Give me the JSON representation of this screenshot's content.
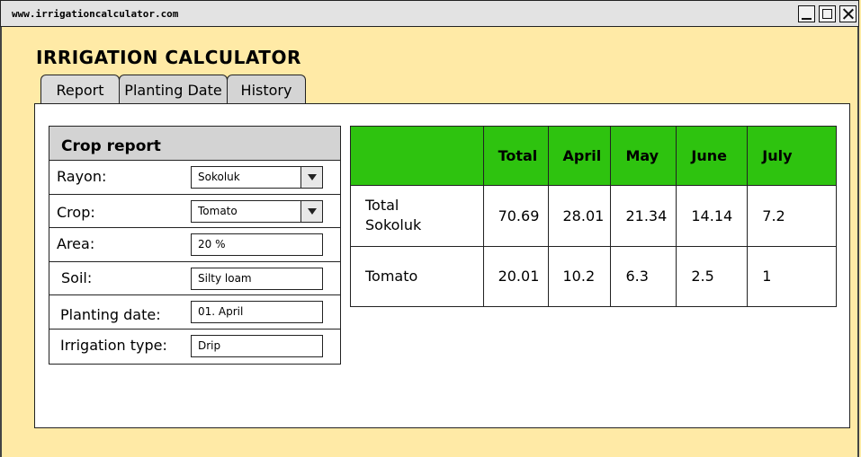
{
  "window": {
    "url": "www.irrigationcalculator.com"
  },
  "app": {
    "title": "IRRIGATION CALCULATOR"
  },
  "tabs": [
    {
      "label": "Report"
    },
    {
      "label": "Planting Date"
    },
    {
      "label": "History"
    }
  ],
  "crop_report": {
    "title": "Crop report",
    "fields": {
      "rayon": {
        "label": "Rayon:",
        "value": "Sokoluk"
      },
      "crop": {
        "label": "Crop:",
        "value": "Tomato"
      },
      "area": {
        "label": "Area:",
        "value": "20 %"
      },
      "soil": {
        "label": "Soil:",
        "value": "Silty loam"
      },
      "planting_date": {
        "label": "Planting date:",
        "value": "01. April"
      },
      "irrigation_type": {
        "label": "Irrigation type:",
        "value": "Drip"
      }
    }
  },
  "table": {
    "headers": [
      "",
      "Total",
      "April",
      "May",
      "June",
      "July"
    ],
    "rows": [
      {
        "name": "Total\nSokoluk",
        "cells": [
          "70.69",
          "28.01",
          "21.34",
          "14.14",
          "7.2"
        ]
      },
      {
        "name": "Tomato",
        "cells": [
          "20.01",
          "10.2",
          "6.3",
          "2.5",
          "1"
        ]
      }
    ]
  },
  "colors": {
    "background": "#ffeaa6",
    "table_header": "#2ec30f"
  }
}
